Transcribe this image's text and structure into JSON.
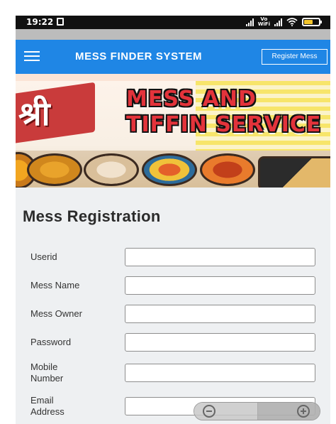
{
  "status_bar": {
    "time": "19:22",
    "volte_top": "Vo",
    "volte_bottom": "WiFi"
  },
  "navbar": {
    "brand": "MESS FINDER SYSTEM",
    "register_button": "Register Mess"
  },
  "banner": {
    "hindi_text": "श्री",
    "title_line1": "MESS AND",
    "title_line2": "TIFFIN SERVICE"
  },
  "form": {
    "title": "Mess Registration",
    "fields": [
      {
        "label": "Userid",
        "value": ""
      },
      {
        "label": "Mess Name",
        "value": ""
      },
      {
        "label": "Mess Owner",
        "value": ""
      },
      {
        "label": "Password",
        "value": ""
      },
      {
        "label": "Mobile Number",
        "value": ""
      },
      {
        "label": "Email Address",
        "value": ""
      }
    ]
  },
  "colors": {
    "navbar": "#1f86e5",
    "form_background": "#eef0f2",
    "banner_title": "#e3333b"
  },
  "icons": [
    "menu-icon",
    "signal-icon",
    "wifi-icon",
    "battery-icon",
    "zoom-out-icon",
    "zoom-in-icon"
  ]
}
